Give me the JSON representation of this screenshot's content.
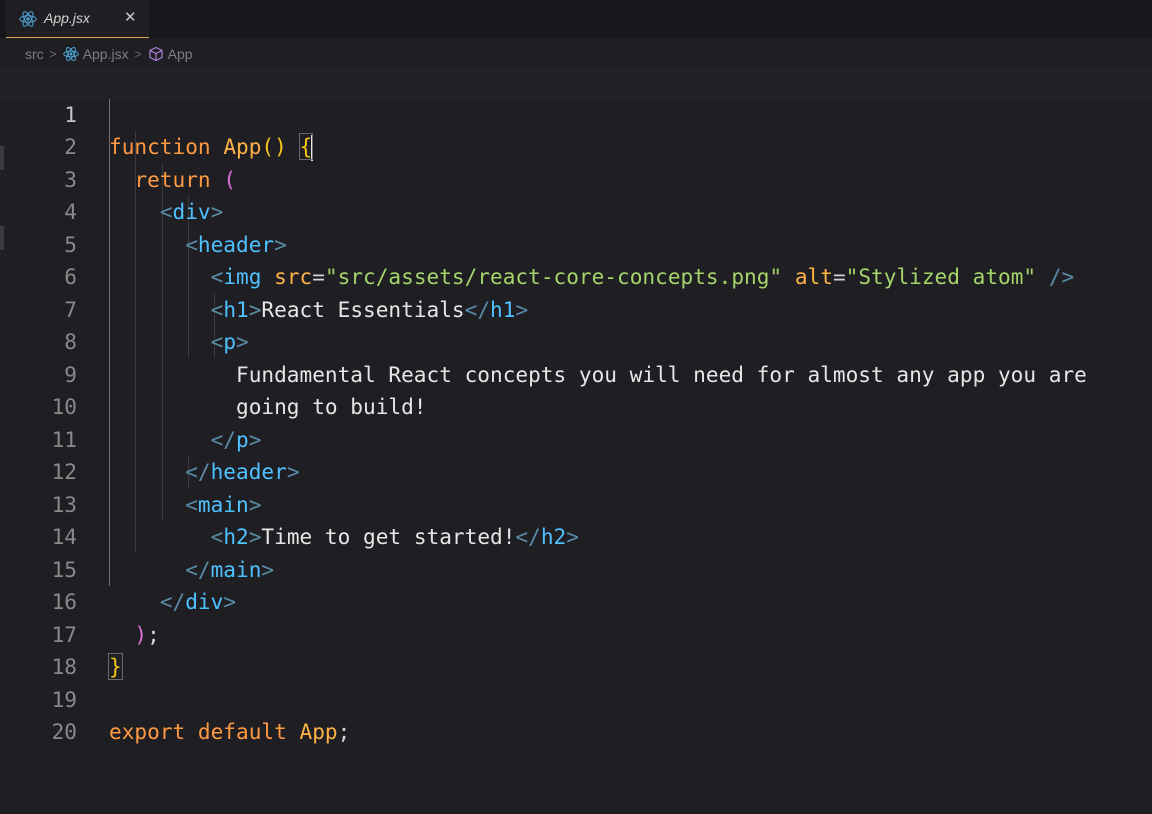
{
  "tab": {
    "label": "App.jsx",
    "close": "✕"
  },
  "breadcrumb": {
    "folder": "src",
    "file": "App.jsx",
    "symbol": "App"
  },
  "editor": {
    "line_numbers": [
      "1",
      "2",
      "3",
      "4",
      "5",
      "6",
      "7",
      "8",
      "9",
      "10",
      "11",
      "12",
      "13",
      "14",
      "15",
      "16",
      "17",
      "18",
      "19",
      "20"
    ],
    "l1": {
      "kw": "function",
      "name": "App",
      "parens": "()",
      "brace": "{"
    },
    "l2": {
      "kw": "return",
      "paren": "("
    },
    "l3": {
      "open": "<",
      "tag": "div",
      "close": ">"
    },
    "l4": {
      "open": "<",
      "tag": "header",
      "close": ">"
    },
    "l5": {
      "open": "<",
      "tag": "img",
      "attr1": "src",
      "eq1": "=",
      "val1": "\"src/assets/react-core-concepts.png\"",
      "attr2": "alt",
      "eq2": "=",
      "val2": "\"Stylized atom\"",
      "close": "/>"
    },
    "l6": {
      "open": "<",
      "tag": "h1",
      "close": ">",
      "text": "React Essentials",
      "open2": "</",
      "tag2": "h1",
      "close2": ">"
    },
    "l7": {
      "open": "<",
      "tag": "p",
      "close": ">"
    },
    "l8": {
      "text": "Fundamental React concepts you will need for almost any app you are"
    },
    "l9": {
      "text": "going to build!"
    },
    "l10": {
      "open": "</",
      "tag": "p",
      "close": ">"
    },
    "l11": {
      "open": "</",
      "tag": "header",
      "close": ">"
    },
    "l12": {
      "open": "<",
      "tag": "main",
      "close": ">"
    },
    "l13": {
      "open": "<",
      "tag": "h2",
      "close": ">",
      "text": "Time to get started!",
      "open2": "</",
      "tag2": "h2",
      "close2": ">"
    },
    "l14": {
      "open": "</",
      "tag": "main",
      "close": ">"
    },
    "l15": {
      "open": "</",
      "tag": "div",
      "close": ">"
    },
    "l16": {
      "paren": ")",
      "semi": ";"
    },
    "l17": {
      "brace": "}"
    },
    "l19": {
      "kw1": "export",
      "kw2": "default",
      "name": "App",
      "semi": ";"
    }
  },
  "colors": {
    "background": "#1e1e23",
    "keyword": "#ff9a42",
    "string": "#a5d46a",
    "tag": "#4fc1ff",
    "bracket_gold": "#f5c518",
    "bracket_pink": "#da70d6"
  },
  "icons": {
    "tab": "react-icon",
    "breadcrumb_file": "react-icon",
    "breadcrumb_symbol": "cube-icon"
  }
}
